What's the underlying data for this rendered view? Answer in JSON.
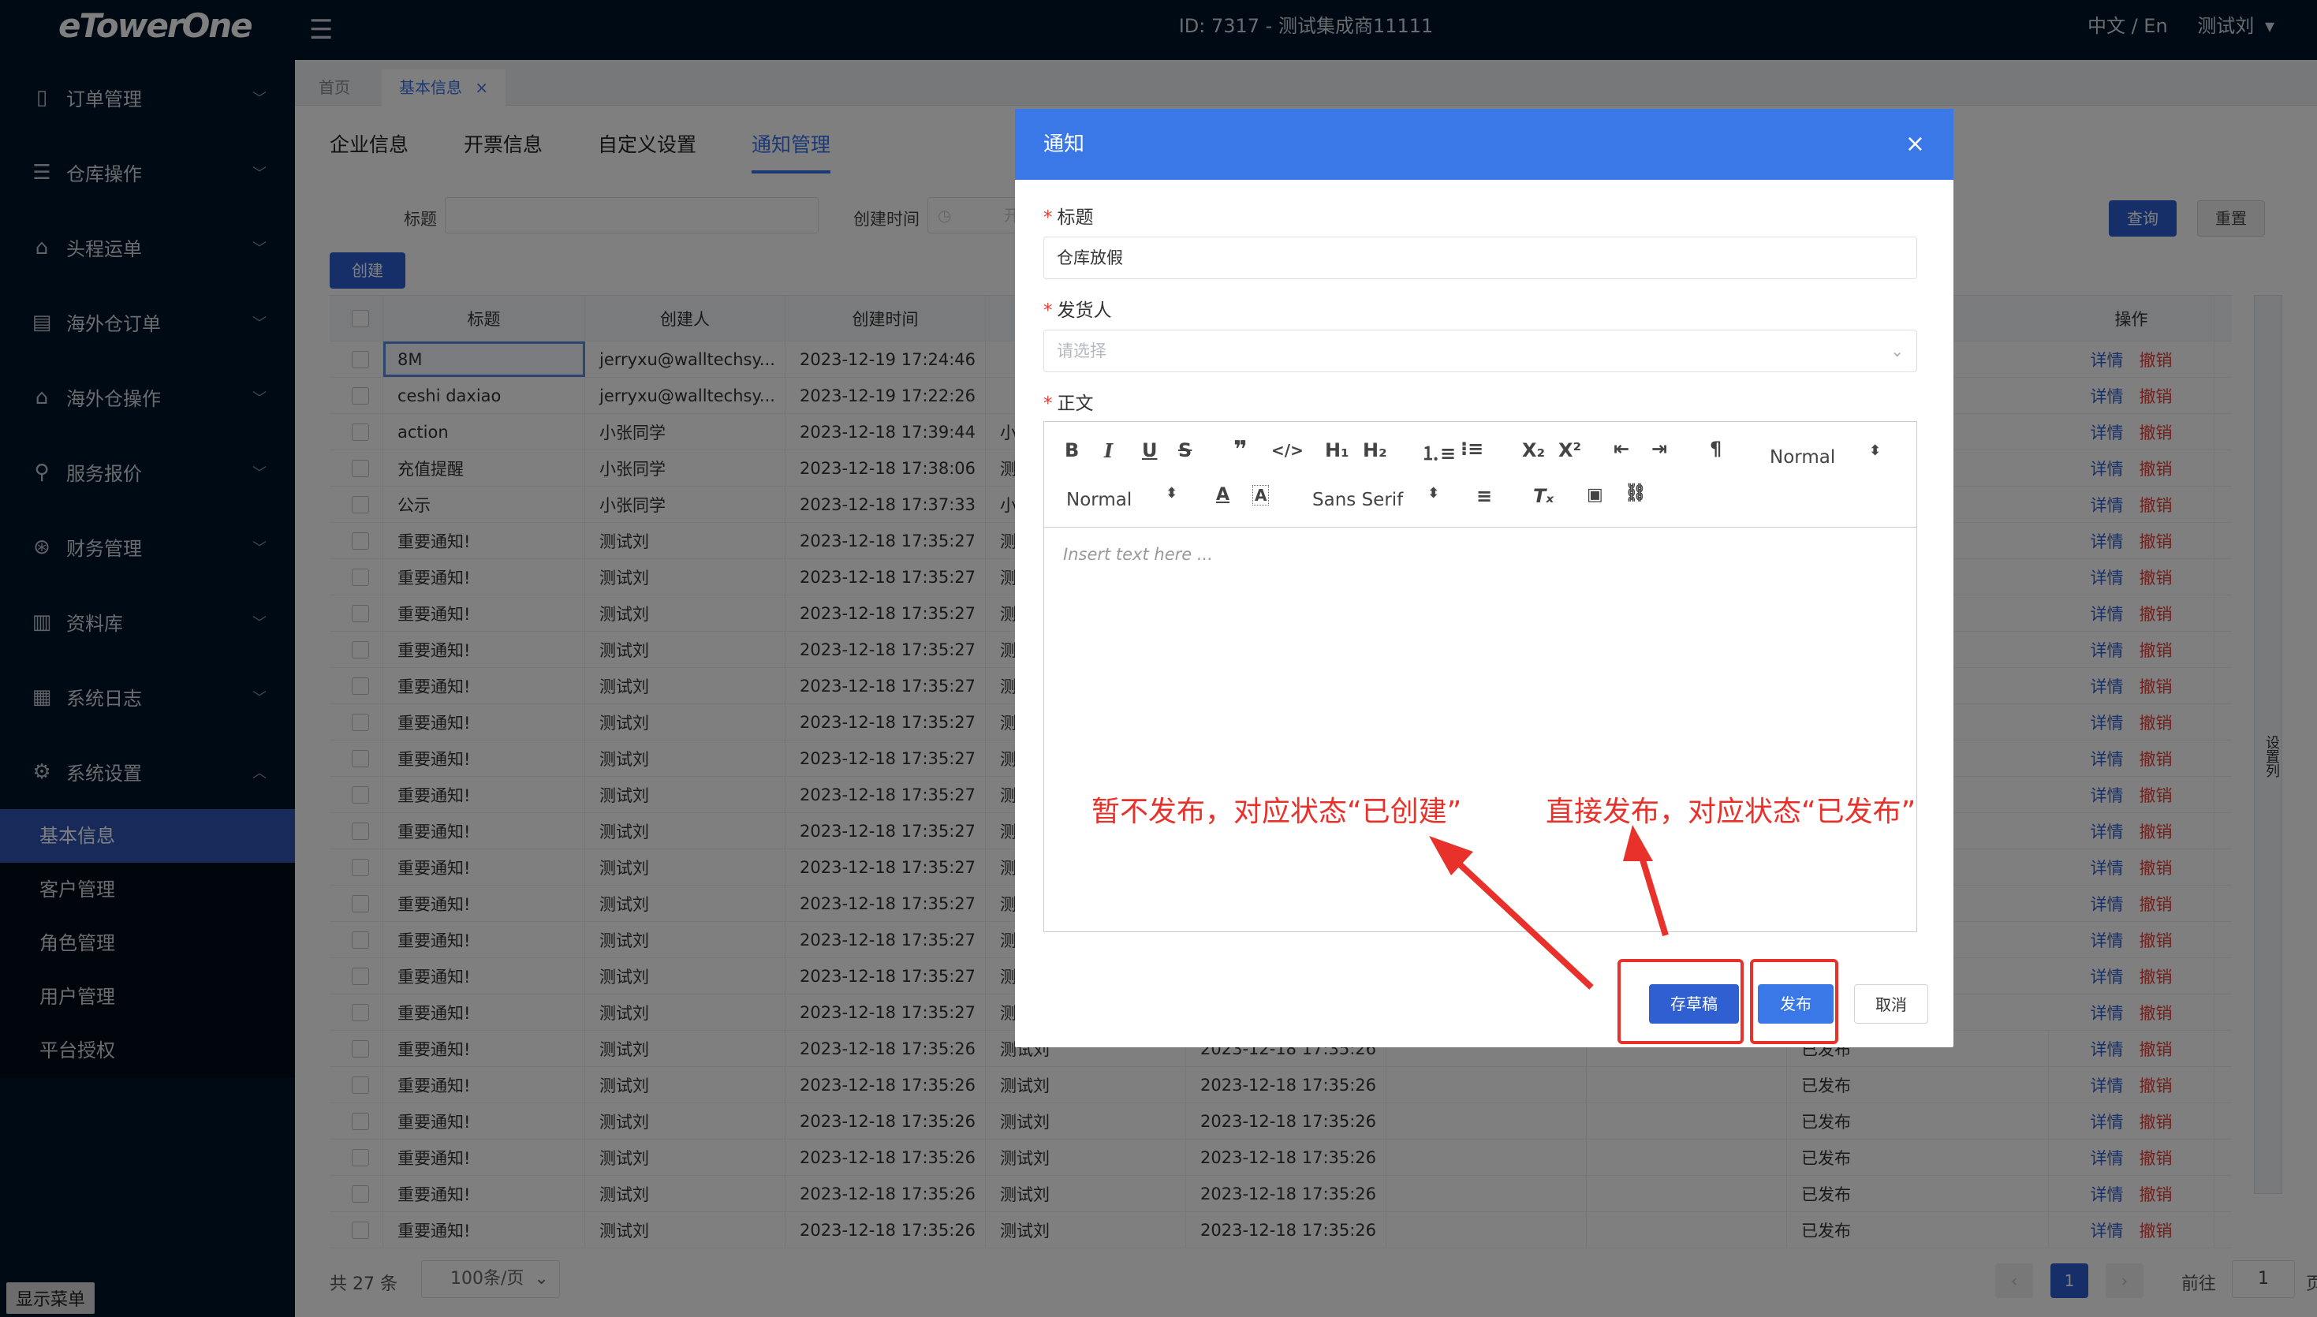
{
  "logo": "eTowerOne",
  "topbar": {
    "title": "ID: 7317 - 测试集成商11111",
    "lang": "中文 / En",
    "user": "测试刘"
  },
  "sidebar": {
    "items": [
      {
        "label": "订单管理",
        "icon": "order-icon"
      },
      {
        "label": "仓库操作",
        "icon": "warehouse-icon"
      },
      {
        "label": "头程运单",
        "icon": "waybill-icon"
      },
      {
        "label": "海外仓订单",
        "icon": "overseas-order-icon"
      },
      {
        "label": "海外仓操作",
        "icon": "overseas-ops-icon"
      },
      {
        "label": "服务报价",
        "icon": "quote-icon"
      },
      {
        "label": "财务管理",
        "icon": "finance-icon"
      },
      {
        "label": "资料库",
        "icon": "library-icon"
      },
      {
        "label": "系统日志",
        "icon": "log-icon"
      },
      {
        "label": "系统设置",
        "icon": "settings-icon"
      }
    ],
    "sub_items": [
      "基本信息",
      "客户管理",
      "角色管理",
      "用户管理",
      "平台授权"
    ],
    "show_menu": "显示菜单"
  },
  "tabs": {
    "home": "首页",
    "basic": "基本信息",
    "close": "×"
  },
  "subtabs": [
    "企业信息",
    "开票信息",
    "自定义设置",
    "通知管理"
  ],
  "filters": {
    "title_label": "标题",
    "created_label": "创建时间",
    "date_placeholder": "开",
    "create_btn": "创建",
    "search_btn": "查询",
    "reset_btn": "重置"
  },
  "table": {
    "headers": [
      "标题",
      "创建人",
      "创建时间",
      "操作"
    ],
    "rows": [
      [
        "8M",
        "jerryxu@walltechsy...",
        "2023-12-19 17:24:46"
      ],
      [
        "ceshi daxiao",
        "jerryxu@walltechsy...",
        "2023-12-19 17:22:26"
      ],
      [
        "action",
        "小张同学",
        "2023-12-18 17:39:44"
      ],
      [
        "充值提醒",
        "小张同学",
        "2023-12-18 17:38:06"
      ],
      [
        "公示",
        "小张同学",
        "2023-12-18 17:37:33"
      ],
      [
        "重要通知!",
        "测试刘",
        "2023-12-18 17:35:27"
      ],
      [
        "重要通知!",
        "测试刘",
        "2023-12-18 17:35:27"
      ],
      [
        "重要通知!",
        "测试刘",
        "2023-12-18 17:35:27"
      ],
      [
        "重要通知!",
        "测试刘",
        "2023-12-18 17:35:27"
      ],
      [
        "重要通知!",
        "测试刘",
        "2023-12-18 17:35:27"
      ],
      [
        "重要通知!",
        "测试刘",
        "2023-12-18 17:35:27"
      ],
      [
        "重要通知!",
        "测试刘",
        "2023-12-18 17:35:27"
      ],
      [
        "重要通知!",
        "测试刘",
        "2023-12-18 17:35:27"
      ],
      [
        "重要通知!",
        "测试刘",
        "2023-12-18 17:35:27"
      ],
      [
        "重要通知!",
        "测试刘",
        "2023-12-18 17:35:27"
      ],
      [
        "重要通知!",
        "测试刘",
        "2023-12-18 17:35:27"
      ],
      [
        "重要通知!",
        "测试刘",
        "2023-12-18 17:35:27"
      ],
      [
        "重要通知!",
        "测试刘",
        "2023-12-18 17:35:27"
      ],
      [
        "重要通知!",
        "测试刘",
        "2023-12-18 17:35:27"
      ],
      [
        "重要通知!",
        "测试刘",
        "2023-12-18 17:35:26",
        "测试刘",
        "2023-12-18 17:35:26",
        "已发布"
      ],
      [
        "重要通知!",
        "测试刘",
        "2023-12-18 17:35:26",
        "测试刘",
        "2023-12-18 17:35:26",
        "已发布"
      ],
      [
        "重要通知!",
        "测试刘",
        "2023-12-18 17:35:26",
        "测试刘",
        "2023-12-18 17:35:26",
        "已发布"
      ],
      [
        "重要通知!",
        "测试刘",
        "2023-12-18 17:35:26",
        "测试刘",
        "2023-12-18 17:35:26",
        "已发布"
      ],
      [
        "重要通知!",
        "测试刘",
        "2023-12-18 17:35:26",
        "测试刘",
        "2023-12-18 17:35:26",
        "已发布"
      ],
      [
        "重要通知!",
        "测试刘",
        "2023-12-18 17:35:26",
        "测试刘",
        "2023-12-18 17:35:26",
        "已发布"
      ]
    ],
    "col4_partial": [
      "",
      "",
      "小",
      "测",
      "小",
      "测",
      "测",
      "测",
      "测",
      "测",
      "测",
      "测",
      "测",
      "测",
      "测",
      "测",
      "测",
      "测",
      "测"
    ],
    "action_detail": "详情",
    "action_revoke": "撤销",
    "settings_col": "设置列"
  },
  "pager": {
    "total": "共 27 条",
    "page_size": "100条/页",
    "current": "1",
    "goto": "前往",
    "goto_value": "1",
    "page_unit": "页"
  },
  "modal": {
    "title": "通知",
    "close": "×",
    "title_label": "标题",
    "title_value": "仓库放假",
    "sender_label": "发货人",
    "sender_placeholder": "请选择",
    "body_label": "正文",
    "editor": {
      "header_select": "Normal",
      "size_select": "Normal",
      "font_select": "Sans Serif",
      "placeholder": "Insert text here ..."
    },
    "draft_btn": "存草稿",
    "publish_btn": "发布",
    "cancel_btn": "取消"
  },
  "annotations": {
    "draft_note": "暂不发布，对应状态“已创建”",
    "publish_note": "直接发布，对应状态“已发布”"
  },
  "colors": {
    "sidebar": "#001529",
    "accent": "#3b78e7",
    "annotation": "#e8312a"
  }
}
